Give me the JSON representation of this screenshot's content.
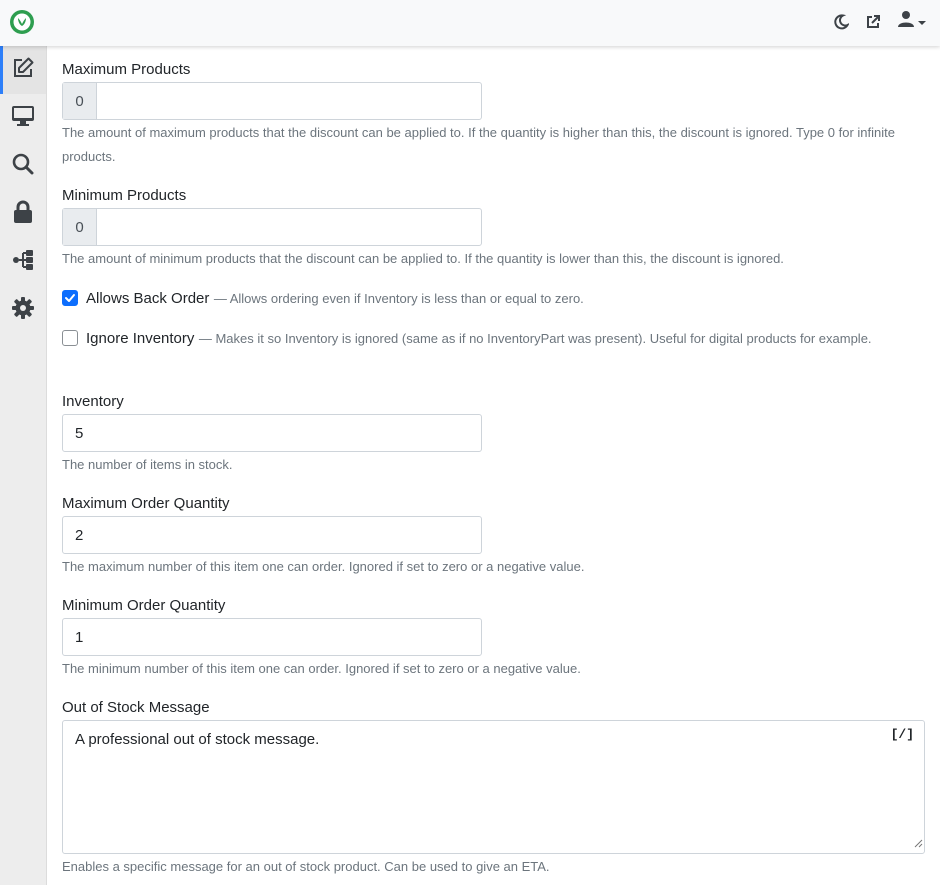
{
  "topbar": {
    "logo_icon": "leaf-circle-logo",
    "icons": [
      "moon-icon",
      "external-link-icon",
      "user-icon",
      "caret-down-icon"
    ]
  },
  "sidebar": {
    "items": [
      {
        "icon": "edit-icon",
        "active": true
      },
      {
        "icon": "desktop-icon",
        "active": false
      },
      {
        "icon": "search-icon",
        "active": false
      },
      {
        "icon": "lock-icon",
        "active": false
      },
      {
        "icon": "sitemap-icon",
        "active": false
      },
      {
        "icon": "gear-icon",
        "active": false
      }
    ]
  },
  "form": {
    "max_products": {
      "label": "Maximum Products",
      "prefix": "0",
      "value": "",
      "help": "The amount of maximum products that the discount can be applied to. If the quantity is higher than this, the discount is ignored. Type 0 for infinite products."
    },
    "min_products": {
      "label": "Minimum Products",
      "prefix": "0",
      "value": "",
      "help": "The amount of minimum products that the discount can be applied to. If the quantity is lower than this, the discount is ignored."
    },
    "allows_back_order": {
      "label": "Allows Back Order",
      "desc": "— Allows ordering even if Inventory is less than or equal to zero.",
      "checked": true
    },
    "ignore_inventory": {
      "label": "Ignore Inventory",
      "desc": "— Makes it so Inventory is ignored (same as if no InventoryPart was present). Useful for digital products for example.",
      "checked": false
    },
    "inventory": {
      "label": "Inventory",
      "value": "5",
      "help": "The number of items in stock."
    },
    "max_order_quantity": {
      "label": "Maximum Order Quantity",
      "value": "2",
      "help": "The maximum number of this item one can order. Ignored if set to zero or a negative value."
    },
    "min_order_quantity": {
      "label": "Minimum Order Quantity",
      "value": "1",
      "help": "The minimum number of this item one can order. Ignored if set to zero or a negative value."
    },
    "out_of_stock_message": {
      "label": "Out of Stock Message",
      "value": "A professional out of stock message.",
      "toggle_label": "[/]",
      "help": "Enables a specific message for an out of stock product. Can be used to give an ETA."
    }
  },
  "colors": {
    "accent": "#0d6efd",
    "logo_green": "#2e9e4f",
    "sidebar_active": "#2d7ff9",
    "icon": "#3d4247"
  }
}
